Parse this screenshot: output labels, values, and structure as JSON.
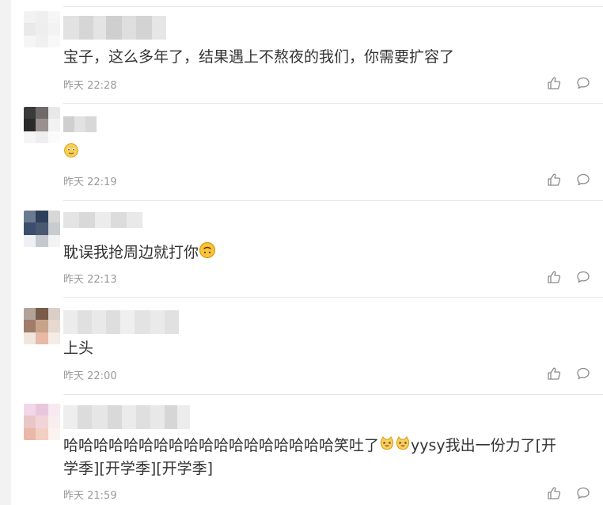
{
  "comments": [
    {
      "text": "宝子，这么多年了，结果遇上不熬夜的我们，你需要扩容了",
      "time": "昨天 22:28"
    },
    {
      "text": "",
      "time": "昨天 22:19"
    },
    {
      "text": "耽误我抢周边就打你",
      "time": "昨天 22:13"
    },
    {
      "text": "上头",
      "time": "昨天 22:00"
    },
    {
      "text_line1": "哈哈哈哈哈哈哈哈哈哈哈哈哈哈哈哈哈哈笑吐了",
      "text_line1_after": "yysy我出一份力了[开",
      "text_line2": "学季][开学季][开学季]",
      "time": "昨天 21:59"
    }
  ],
  "icons": {
    "like": "like-icon",
    "reply": "comment-icon",
    "emoji_smile": "smile-emoji-icon",
    "emoji_upside": "upside-down-face-icon",
    "emoji_laugh": "laughing-cat-icon"
  },
  "colors": {
    "text": "#333333",
    "meta": "#999999",
    "divider": "#e6e6e6"
  }
}
